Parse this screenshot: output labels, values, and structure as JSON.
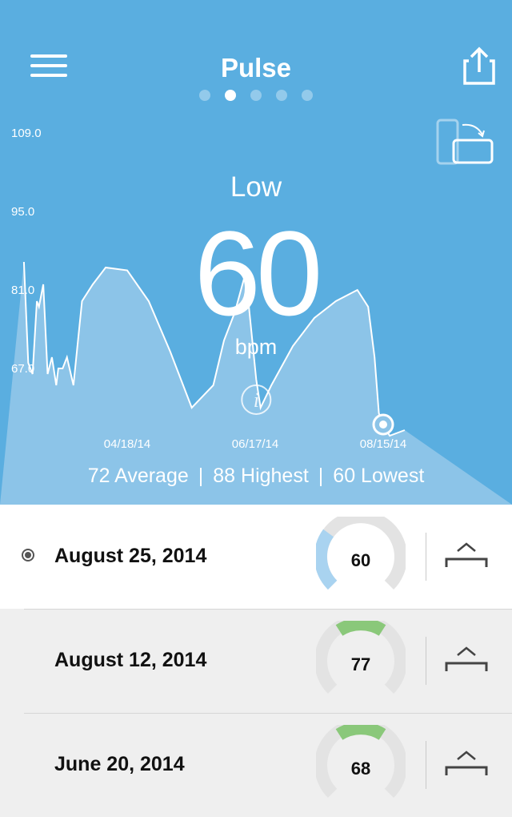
{
  "header": {
    "title": "Pulse",
    "page_count": 5,
    "active_page": 1,
    "menu_icon": "hamburger-menu-icon",
    "share_icon": "share-icon",
    "rotate_icon": "rotate-device-icon"
  },
  "reading": {
    "status": "Low",
    "value": "60",
    "unit": "bpm"
  },
  "colors": {
    "hero_bg": "#5aaee0",
    "chart_fill": "#8cc4e8",
    "gauge_low": "#a9d3f0",
    "gauge_normal": "#8ac87a",
    "gauge_track": "#e3e3e3"
  },
  "chart_data": {
    "type": "area",
    "y_ticks": [
      "109.0",
      "95.0",
      "81.0",
      "67.0"
    ],
    "x_ticks": [
      "04/18/14",
      "06/17/14",
      "08/15/14"
    ],
    "ylim": [
      53,
      116
    ],
    "grid": false,
    "x": [
      "03/01/14",
      "03/03/14",
      "03/05/14",
      "03/07/14",
      "03/08/14",
      "03/10/14",
      "03/12/14",
      "03/14/14",
      "03/16/14",
      "03/17/14",
      "03/19/14",
      "03/21/14",
      "03/24/14",
      "03/28/14",
      "04/02/14",
      "04/08/14",
      "04/18/14",
      "04/28/14",
      "05/08/14",
      "05/18/14",
      "05/28/14",
      "06/02/14",
      "06/07/14",
      "06/12/14",
      "06/17/14",
      "06/19/14",
      "06/24/14",
      "07/04/14",
      "07/14/14",
      "07/24/14",
      "08/03/14",
      "08/08/14",
      "08/11/14",
      "08/13/14",
      "08/15/14",
      "08/18/14",
      "08/25/14"
    ],
    "values": [
      86,
      68,
      66,
      79,
      78,
      82,
      66,
      69,
      64,
      67,
      67,
      69,
      64,
      79,
      82,
      85,
      84.5,
      79,
      70,
      60,
      64,
      72,
      77,
      84,
      65,
      60,
      64,
      71,
      76,
      79,
      81,
      78,
      69,
      59,
      57,
      55,
      56
    ],
    "selected_x": "08/15/14",
    "info_marker_x": "06/17/14"
  },
  "summary": {
    "average": "72 Average",
    "highest": "88 Highest",
    "lowest": "60 Lowest",
    "separator": "|"
  },
  "readings": [
    {
      "date": "August 25, 2014",
      "value": "60",
      "selected": true,
      "level": "low"
    },
    {
      "date": "August 12, 2014",
      "value": "77",
      "selected": false,
      "level": "normal"
    },
    {
      "date": "June 20, 2014",
      "value": "68",
      "selected": false,
      "level": "normal"
    }
  ]
}
